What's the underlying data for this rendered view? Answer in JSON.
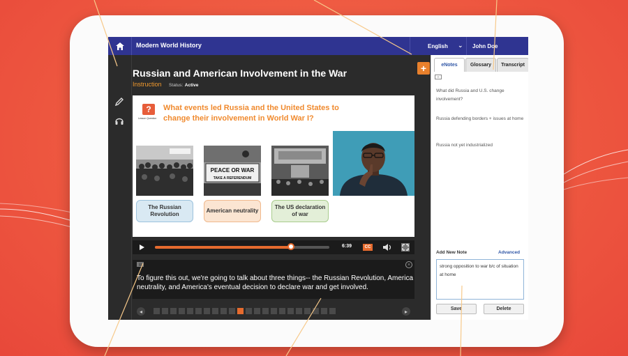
{
  "topbar": {
    "course_title": "Modern World History",
    "language": "English",
    "user": "John Doe"
  },
  "lesson": {
    "title": "Russian and American Involvement in the War",
    "section": "Instruction",
    "status_label": "Status:",
    "status_value": "Active"
  },
  "slide": {
    "question_icon": "?",
    "question_label": "Lesson Question",
    "question": "What events led Russia and the United States to change their involvement in World War I?",
    "photo_sign": [
      "PEACE OR WAR",
      "TAKE A REFERENDUM"
    ],
    "captions": [
      "The Russian Revolution",
      "American neutrality",
      "The US declaration of war"
    ]
  },
  "player": {
    "progress": 0.78,
    "time": "6:39",
    "cc_label": "CC"
  },
  "transcript": {
    "text": "To figure this out, we're going to talk about three things-- the Russian Revolution, America neutrality, and America's eventual decision to declare war and get involved."
  },
  "pager": {
    "total": 22,
    "current": 10
  },
  "notes_panel": {
    "tabs": [
      "eNotes",
      "Glossary",
      "Transcript"
    ],
    "active_tab": 0,
    "notes": [
      "What did Russia and U.S. change involvement?",
      "Russia defending borders + issues at home",
      "Russia not yet industrialized"
    ],
    "add_new_label": "Add New Note",
    "advanced_label": "Advanced",
    "new_note_value": "strong opposition to war b/c of situation at home",
    "save_label": "Save",
    "delete_label": "Delete"
  },
  "colors": {
    "background": "#ee5840",
    "topbar": "#2f3491",
    "accent": "#e66b2e",
    "tab_active_text": "#2f56a6"
  },
  "icons": [
    "home-icon",
    "pencil-icon",
    "headphones-icon",
    "plus-icon",
    "play-icon",
    "volume-icon",
    "fullscreen-icon",
    "chevron-down-icon",
    "close-icon"
  ]
}
